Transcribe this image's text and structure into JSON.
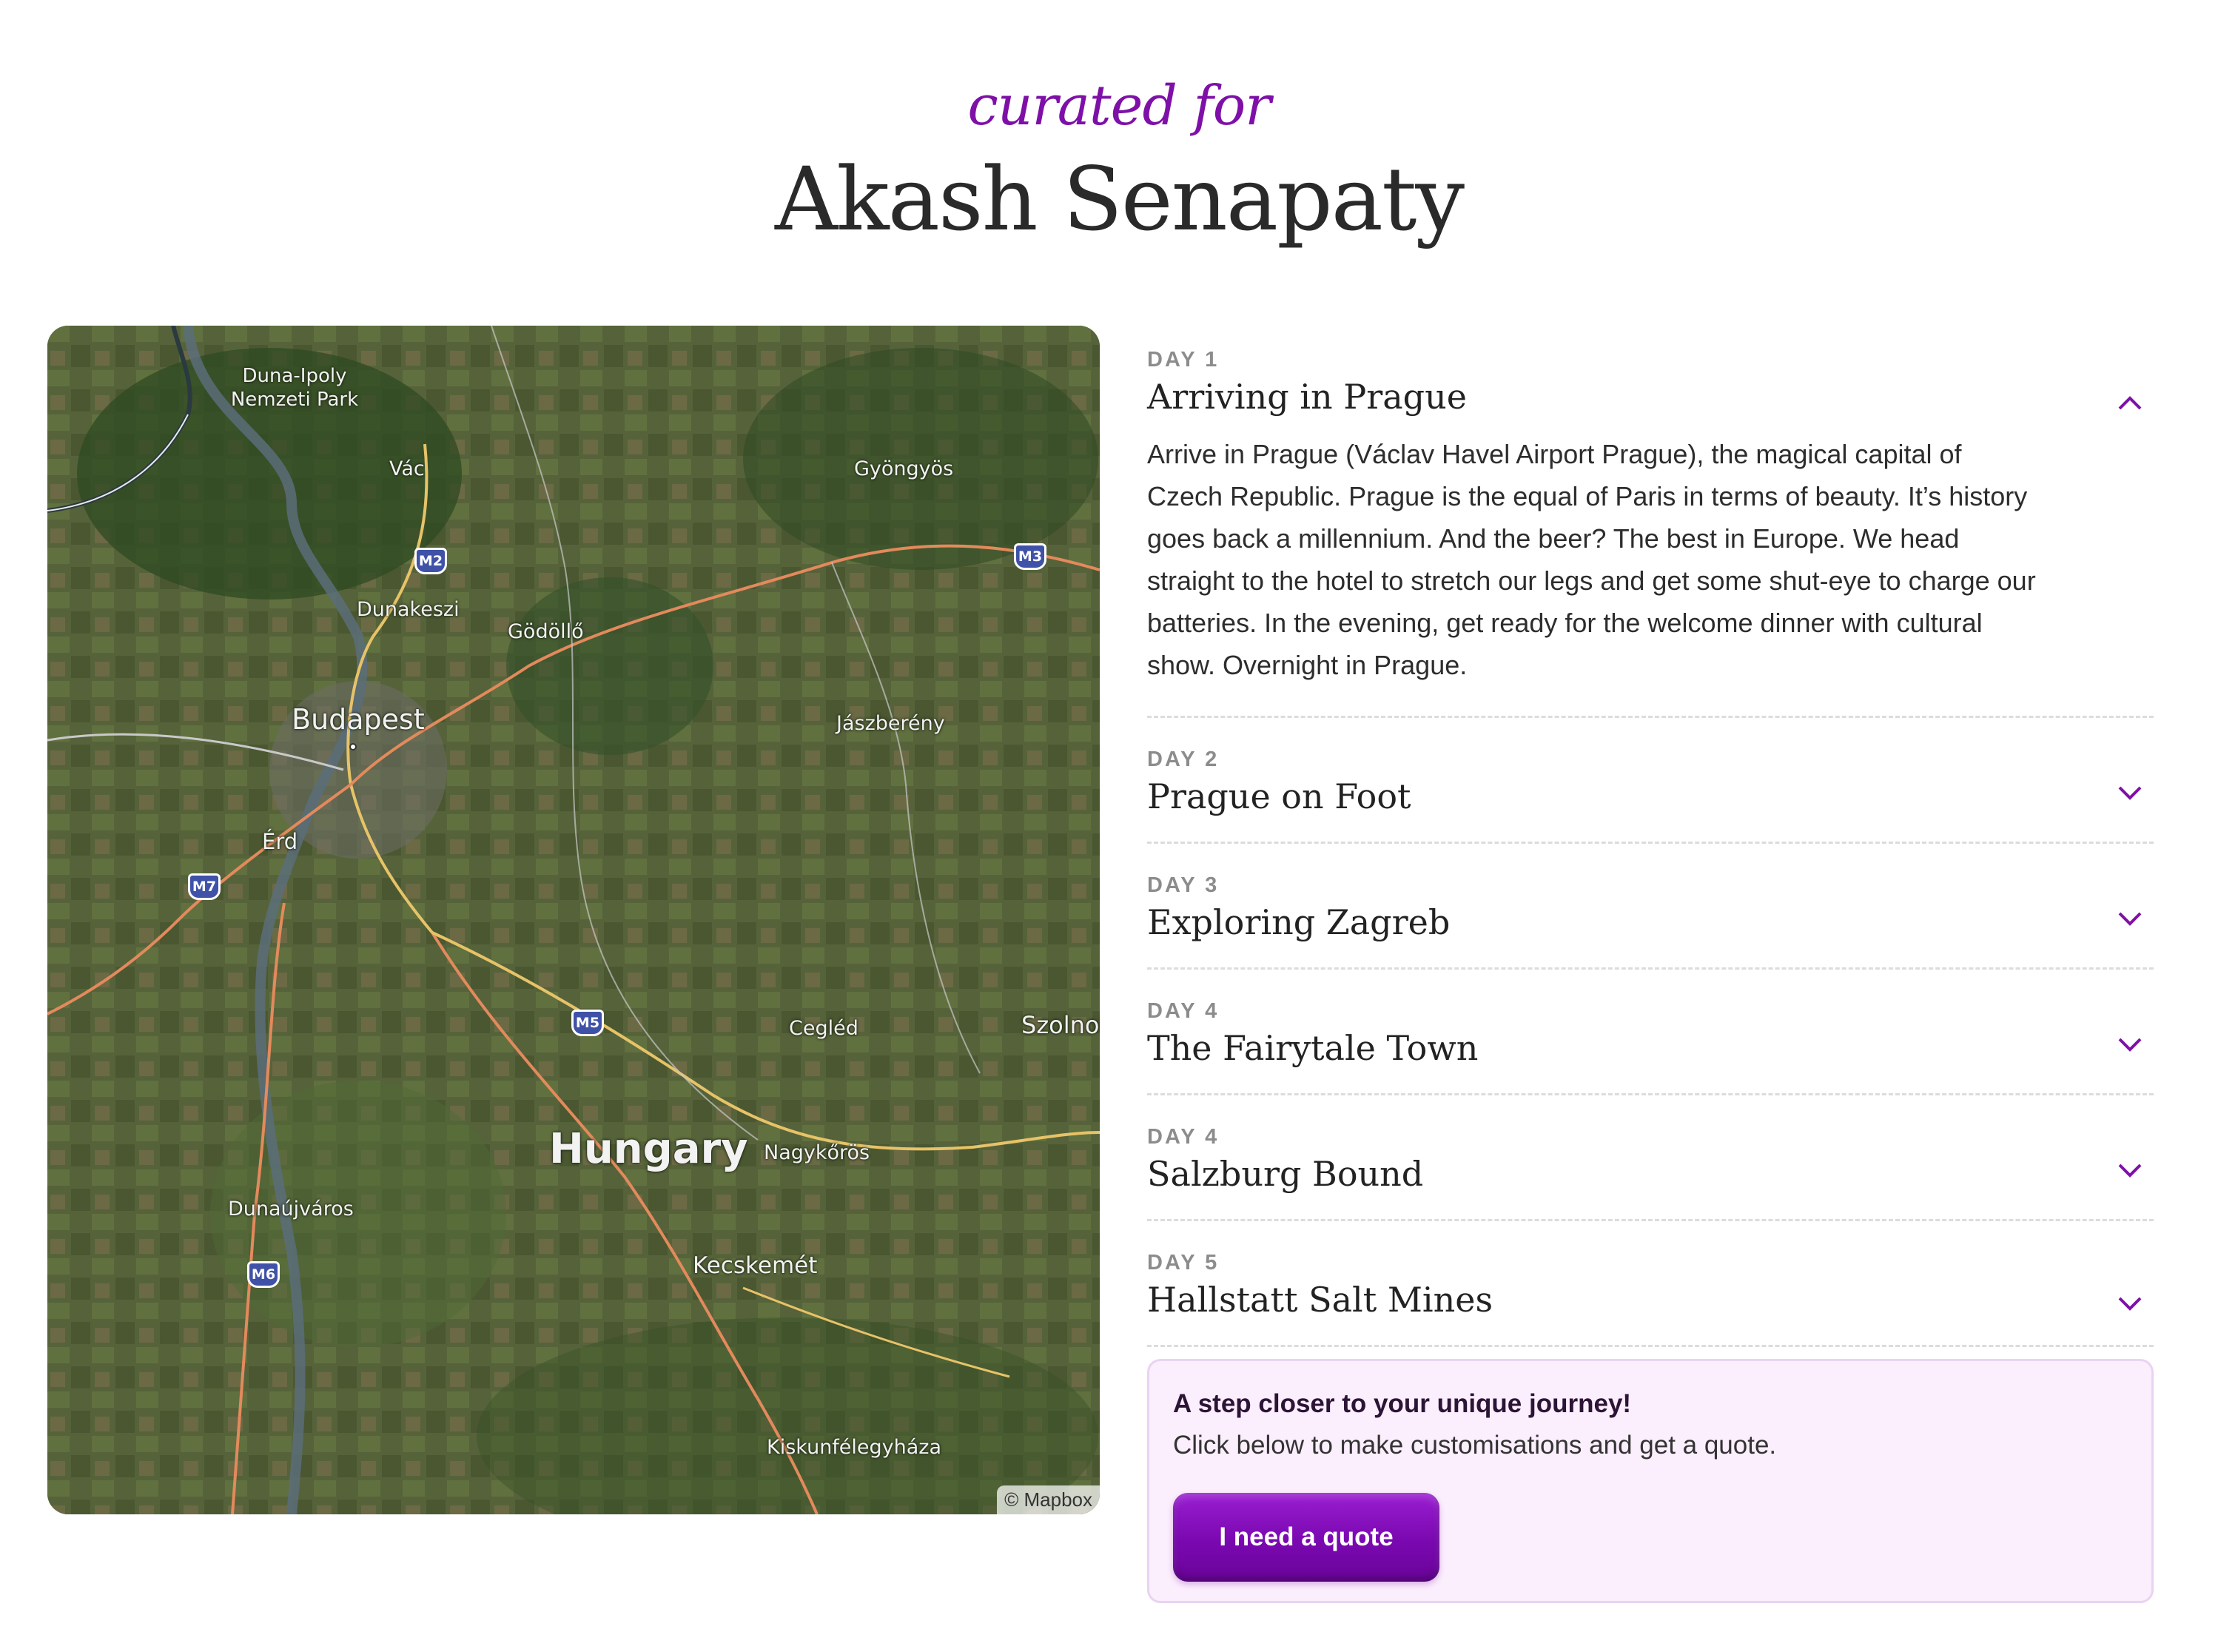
{
  "header": {
    "subtitle": "curated for",
    "name": "Akash Senapaty"
  },
  "map": {
    "attribution": "© Mapbox",
    "country_label": "Hungary",
    "places": [
      "Duna-Ipoly Nemzeti Park",
      "Vác",
      "Gyöngyös",
      "Dunakeszi",
      "Gödöllő",
      "Budapest",
      "Jászberény",
      "Érd",
      "Cegléd",
      "Szolnok",
      "Nagykőrös",
      "Dunaújváros",
      "Kecskemét",
      "Kiskunfélegyháza"
    ],
    "roads": [
      "M2",
      "M3",
      "M7",
      "M5",
      "M6"
    ]
  },
  "itinerary": [
    {
      "day": "DAY 1",
      "title": "Arriving in Prague",
      "expanded": true,
      "description": "Arrive in Prague (Václav Havel Airport Prague), the magical capital of Czech Republic. Prague is the equal of Paris in terms of beauty. It’s history goes back a millennium. And the beer? The best in Europe. We head straight to the hotel to stretch our legs and get some shut-eye to charge our batteries. In the evening, get ready for the welcome dinner with cultural show. Overnight in Prague."
    },
    {
      "day": "DAY 2",
      "title": "Prague on Foot",
      "expanded": false
    },
    {
      "day": "DAY 3",
      "title": "Exploring Zagreb",
      "expanded": false
    },
    {
      "day": "DAY 4",
      "title": "The Fairytale Town",
      "expanded": false
    },
    {
      "day": "DAY 4",
      "title": "Salzburg Bound",
      "expanded": false
    },
    {
      "day": "DAY 5",
      "title": "Hallstatt Salt Mines",
      "expanded": false
    }
  ],
  "cta": {
    "title": "A step closer to your unique journey!",
    "text": "Click below to make customisations and get a quote.",
    "button": "I need a quote"
  },
  "colors": {
    "accent": "#7e10a8",
    "cta_background": "#fbeefd"
  }
}
